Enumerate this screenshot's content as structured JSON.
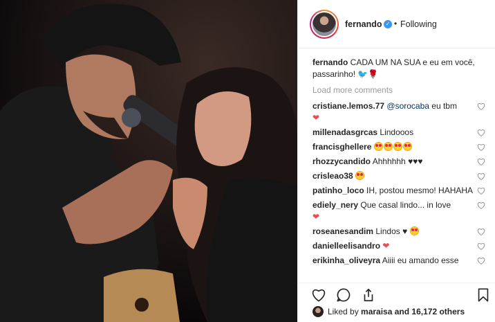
{
  "post": {
    "username": "fernando",
    "following_label": "Following",
    "separator": "•",
    "caption_user": "fernando",
    "caption_text": " CADA UM NA SUA e eu em você, passarinho! 🐦🌹"
  },
  "comments": {
    "load_more_label": "Load more comments",
    "items": [
      {
        "user": "cristiane.lemos.77",
        "mention": "@sorocaba",
        "text": " eu tbm"
      },
      {
        "user": "millenadasgrcas",
        "text": " Lindooos"
      },
      {
        "user": "francisghellere",
        "text": " "
      },
      {
        "user": "rhozzycandido",
        "text": " Ahhhhhh ♥♥♥"
      },
      {
        "user": "crisleao38",
        "text": " "
      },
      {
        "user": "patinho_loco",
        "text": " IH, postou mesmo! HAHAHA"
      },
      {
        "user": "ediely_nery",
        "text": " Que casal lindo... in love"
      },
      {
        "user": "roseanesandim",
        "text": " Lindos ♥"
      },
      {
        "user": "danielleelisandro",
        "text": " "
      },
      {
        "user": "erikinha_oliveyra",
        "text": " Aiiii eu amando esse"
      }
    ]
  },
  "likes": {
    "prefix": "Liked by ",
    "user": "maraisa",
    "suffix": " and 16,172 others"
  },
  "icons": [
    "heart-outline-icon",
    "comment-icon",
    "share-icon",
    "bookmark-icon",
    "verified-icon"
  ],
  "colors": {
    "verified": "#3897f0",
    "heart": "#ed4956",
    "link": "#003569",
    "muted": "#999999"
  }
}
